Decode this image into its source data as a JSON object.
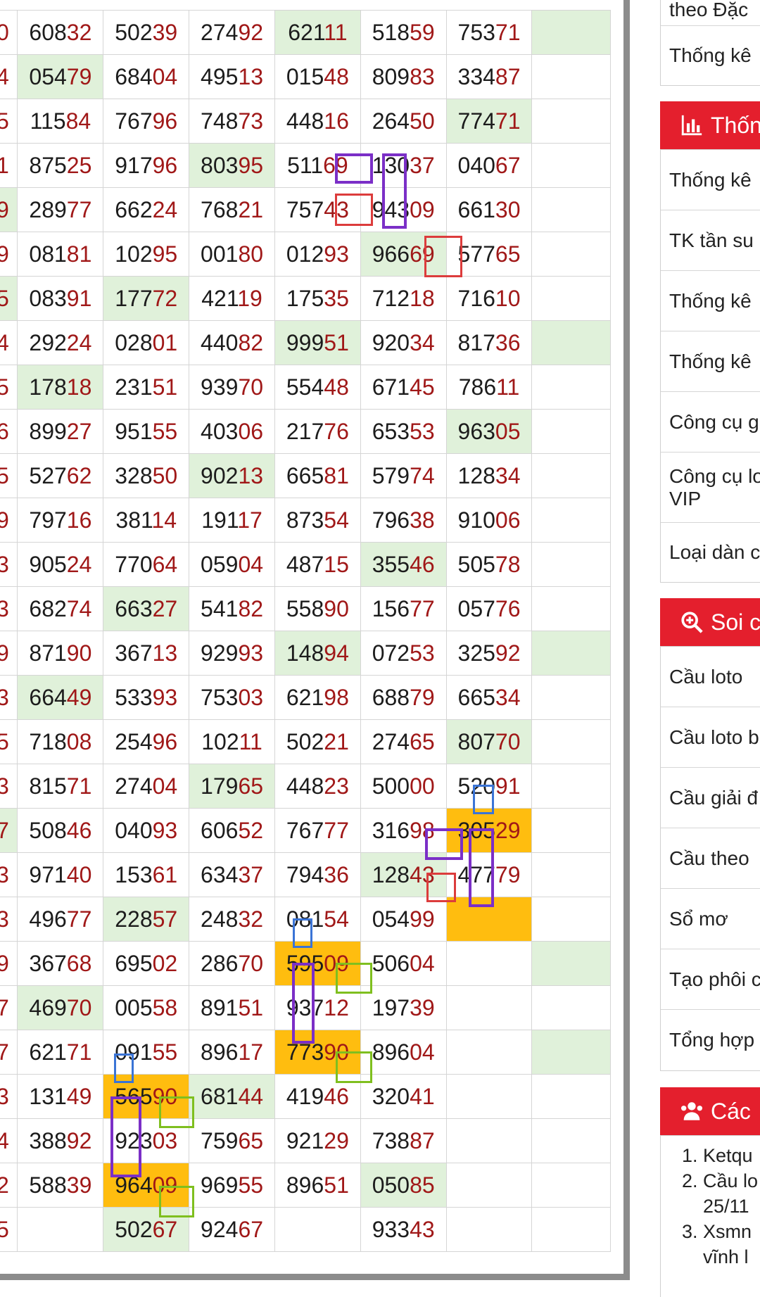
{
  "grid": {
    "left_edge": [
      "0",
      "4",
      "5",
      "1",
      "9",
      "9",
      "5",
      "4",
      "5",
      "6",
      "5",
      "9",
      "3",
      "3",
      "9",
      "3",
      "5",
      "3",
      "7",
      "3",
      "3",
      "9",
      "7",
      "7",
      "3",
      "4",
      "2",
      "5"
    ],
    "rows": [
      [
        "60832",
        "50239",
        "27492",
        "62111",
        "51859",
        "75371",
        ""
      ],
      [
        "05479",
        "68404",
        "49513",
        "01548",
        "80983",
        "33487",
        ""
      ],
      [
        "11584",
        "76796",
        "74873",
        "44816",
        "26450",
        "77471",
        ""
      ],
      [
        "87525",
        "91796",
        "80395",
        "51169",
        "13037",
        "04067",
        ""
      ],
      [
        "28977",
        "66224",
        "76821",
        "75743",
        "94309",
        "66130",
        ""
      ],
      [
        "08181",
        "10295",
        "00180",
        "01293",
        "96669",
        "57765",
        ""
      ],
      [
        "08391",
        "17772",
        "42119",
        "17535",
        "71218",
        "71610",
        ""
      ],
      [
        "29224",
        "02801",
        "44082",
        "99951",
        "92034",
        "81736",
        ""
      ],
      [
        "17818",
        "23151",
        "93970",
        "55448",
        "67145",
        "78611",
        ""
      ],
      [
        "89927",
        "95155",
        "40306",
        "21776",
        "65353",
        "96305",
        ""
      ],
      [
        "52762",
        "32850",
        "90213",
        "66581",
        "57974",
        "12834",
        ""
      ],
      [
        "79716",
        "38114",
        "19117",
        "87354",
        "79638",
        "91006",
        ""
      ],
      [
        "90524",
        "77064",
        "05904",
        "48715",
        "35546",
        "50578",
        ""
      ],
      [
        "68274",
        "66327",
        "54182",
        "55890",
        "15677",
        "05776",
        ""
      ],
      [
        "87190",
        "36713",
        "92993",
        "14894",
        "07253",
        "32592",
        ""
      ],
      [
        "66449",
        "53393",
        "75303",
        "62198",
        "68879",
        "66534",
        ""
      ],
      [
        "71808",
        "25496",
        "10211",
        "50221",
        "27465",
        "80770",
        ""
      ],
      [
        "81571",
        "27404",
        "17965",
        "44823",
        "50000",
        "52091",
        ""
      ],
      [
        "50846",
        "04093",
        "60652",
        "76777",
        "31698",
        "30529",
        ""
      ],
      [
        "97140",
        "15361",
        "63437",
        "79436",
        "12843",
        "47779",
        ""
      ],
      [
        "49677",
        "22857",
        "24832",
        "08154",
        "05499",
        "",
        ""
      ],
      [
        "36768",
        "69502",
        "28670",
        "59509",
        "50604",
        "",
        ""
      ],
      [
        "46970",
        "00558",
        "89151",
        "93712",
        "19739",
        "",
        ""
      ],
      [
        "62171",
        "09155",
        "89617",
        "77390",
        "89604",
        "",
        ""
      ],
      [
        "13149",
        "56590",
        "68144",
        "41946",
        "32041",
        "",
        ""
      ],
      [
        "38892",
        "92303",
        "75965",
        "92129",
        "73887",
        "",
        ""
      ],
      [
        "58839",
        "96409",
        "96955",
        "89651",
        "05085",
        "",
        ""
      ],
      [
        "",
        "50267",
        "92467",
        "",
        "93343",
        "",
        ""
      ]
    ],
    "highlights": {
      "green": [
        [
          0,
          3
        ],
        [
          0,
          6
        ],
        [
          1,
          0
        ],
        [
          2,
          5
        ],
        [
          3,
          2
        ],
        [
          4,
          -1
        ],
        [
          5,
          4
        ],
        [
          6,
          1
        ],
        [
          6,
          -1
        ],
        [
          7,
          3
        ],
        [
          7,
          6
        ],
        [
          8,
          0
        ],
        [
          9,
          5
        ],
        [
          10,
          2
        ],
        [
          12,
          4
        ],
        [
          13,
          1
        ],
        [
          14,
          3
        ],
        [
          14,
          6
        ],
        [
          15,
          0
        ],
        [
          16,
          5
        ],
        [
          17,
          2
        ],
        [
          18,
          -1
        ],
        [
          19,
          4
        ],
        [
          20,
          1
        ],
        [
          21,
          6
        ],
        [
          22,
          0
        ],
        [
          23,
          6
        ],
        [
          24,
          2
        ],
        [
          26,
          4
        ],
        [
          27,
          1
        ]
      ],
      "orange": [
        [
          18,
          5
        ],
        [
          20,
          5
        ],
        [
          21,
          3
        ],
        [
          23,
          3
        ],
        [
          24,
          1
        ],
        [
          26,
          1
        ]
      ]
    },
    "accent_colors": {
      "green_cell": "#e0f1da",
      "orange_cell": "#ffbd0f",
      "red_digits": "#a01818",
      "mark_red": "#dc3c3c",
      "mark_purple": "#7b2fc7",
      "mark_blue": "#3a74d6",
      "mark_green": "#7fbf1f"
    }
  },
  "sidebar": {
    "top_items": [
      "theo Đặc",
      "Thống kê"
    ],
    "section1": {
      "icon": "bar-chart-icon",
      "title": "Thốn",
      "items": [
        "Thống kê",
        "TK tần su",
        "Thống kê",
        "Thống kê",
        "Công cụ g",
        "Công cụ lo",
        "VIP",
        "Loại dàn c"
      ]
    },
    "section2": {
      "icon": "search-plus-icon",
      "title": "Soi c",
      "items": [
        "Cầu loto",
        "Cầu loto b",
        "Cầu giải đ",
        "Cầu theo",
        "Sổ mơ",
        "Tạo phôi c",
        "Tổng hợp"
      ]
    },
    "section3": {
      "icon": "users-icon",
      "title": "Các",
      "items": [
        "1. Ketqu",
        "2. Cầu lo",
        "25/11",
        "3. Xsmn",
        "vĩnh l"
      ]
    }
  }
}
